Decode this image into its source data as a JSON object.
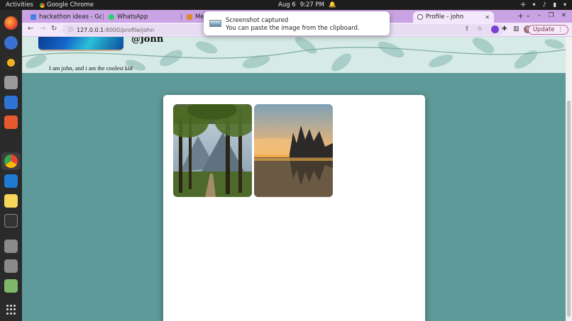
{
  "topbar": {
    "activities": "Activities",
    "app_name": "Google Chrome",
    "date": "Aug 6",
    "time": "9:27 PM"
  },
  "tabs": [
    {
      "label": "hackathon ideas - Go",
      "favicon": "docs-icon",
      "color": "#4a7ee6"
    },
    {
      "label": "WhatsApp",
      "favicon": "whatsapp-icon",
      "color": "#25d366"
    },
    {
      "label": "Mee",
      "favicon": "meet-icon",
      "color": "#e08a2c"
    },
    {
      "label": "Profile - john",
      "favicon": "globe-icon",
      "color": "#555555",
      "active": true
    }
  ],
  "toolbar": {
    "url_host": "127.0.0.1",
    "url_path": ":8000/profile/john",
    "update_label": "Update",
    "profile_initial": "S"
  },
  "profile": {
    "username": "@john",
    "bio": "I am john, and i am the coolest kid"
  },
  "notification": {
    "title": "Screenshot captured",
    "body": "You can paste the image from the clipboard."
  },
  "photos": [
    {
      "name": "forest-path-photo",
      "description_colors": [
        "#2f4a1c",
        "#8fa6b8"
      ]
    },
    {
      "name": "misty-lake-photo",
      "description_colors": [
        "#f3a13b",
        "#3c3b4a"
      ]
    }
  ],
  "colors": {
    "page_bg": "#5f9a9a",
    "tabstrip": "#c9a3e3",
    "toolbar": "#f3e8fb",
    "update_border": "#b06a93"
  }
}
